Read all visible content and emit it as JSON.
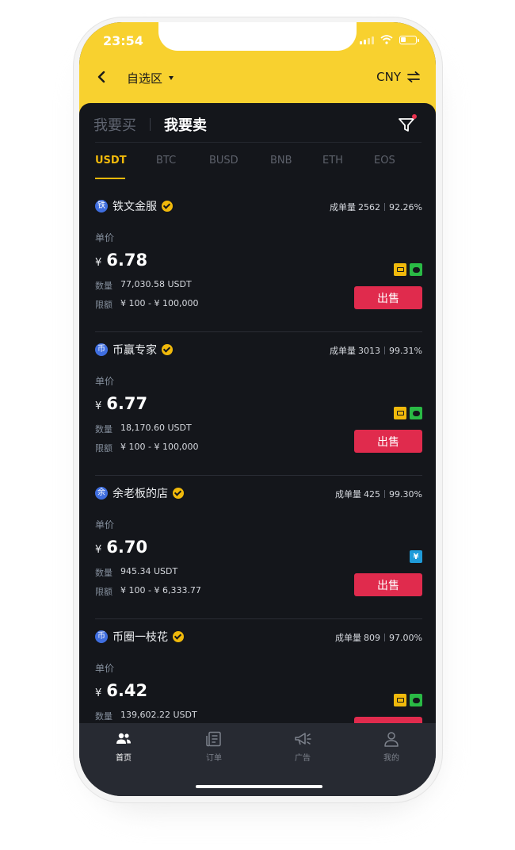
{
  "status_bar": {
    "time": "23:54"
  },
  "nav": {
    "title": "自选区",
    "currency": "CNY"
  },
  "tabs": {
    "buy": "我要买",
    "sell": "我要卖"
  },
  "coins": [
    "USDT",
    "BTC",
    "BUSD",
    "BNB",
    "ETH",
    "EOS"
  ],
  "labels": {
    "price": "单价",
    "quantity": "数量",
    "limit": "限额",
    "orders": "成单量",
    "currency_symbol": "¥"
  },
  "merchants": [
    {
      "avatar": "铁",
      "name": "铁文金服",
      "orders": "2562",
      "rate": "92.26%",
      "price": "6.78",
      "quantity": "77,030.58 USDT",
      "limit": "¥ 100 - ¥ 100,000",
      "payments": [
        "bank-transfer",
        "bank-card",
        "wechat-pay"
      ],
      "action": "出售"
    },
    {
      "avatar": "币",
      "name": "币赢专家",
      "orders": "3013",
      "rate": "99.31%",
      "price": "6.77",
      "quantity": "18,170.60 USDT",
      "limit": "¥ 100 - ¥ 100,000",
      "payments": [
        "bank-transfer",
        "bank-card",
        "wechat-pay"
      ],
      "action": "出售"
    },
    {
      "avatar": "余",
      "name": "余老板的店",
      "orders": "425",
      "rate": "99.30%",
      "price": "6.70",
      "quantity": "945.34 USDT",
      "limit": "¥ 100 - ¥ 6,333.77",
      "payments": [
        "bank-transfer"
      ],
      "action": "出售"
    },
    {
      "avatar": "币",
      "name": "币圈一枝花",
      "orders": "809",
      "rate": "97.00%",
      "price": "6.42",
      "quantity": "139,602.22 USDT",
      "payments": [
        "bank-transfer",
        "bank-card",
        "wechat-pay"
      ]
    }
  ],
  "bottom_nav": [
    "首页",
    "订单",
    "广告",
    "我的"
  ],
  "colors": {
    "brand_yellow": "#f8d12f",
    "accent_gold": "#f0b90b",
    "sell_red": "#e02b4d",
    "background": "#14161b"
  }
}
